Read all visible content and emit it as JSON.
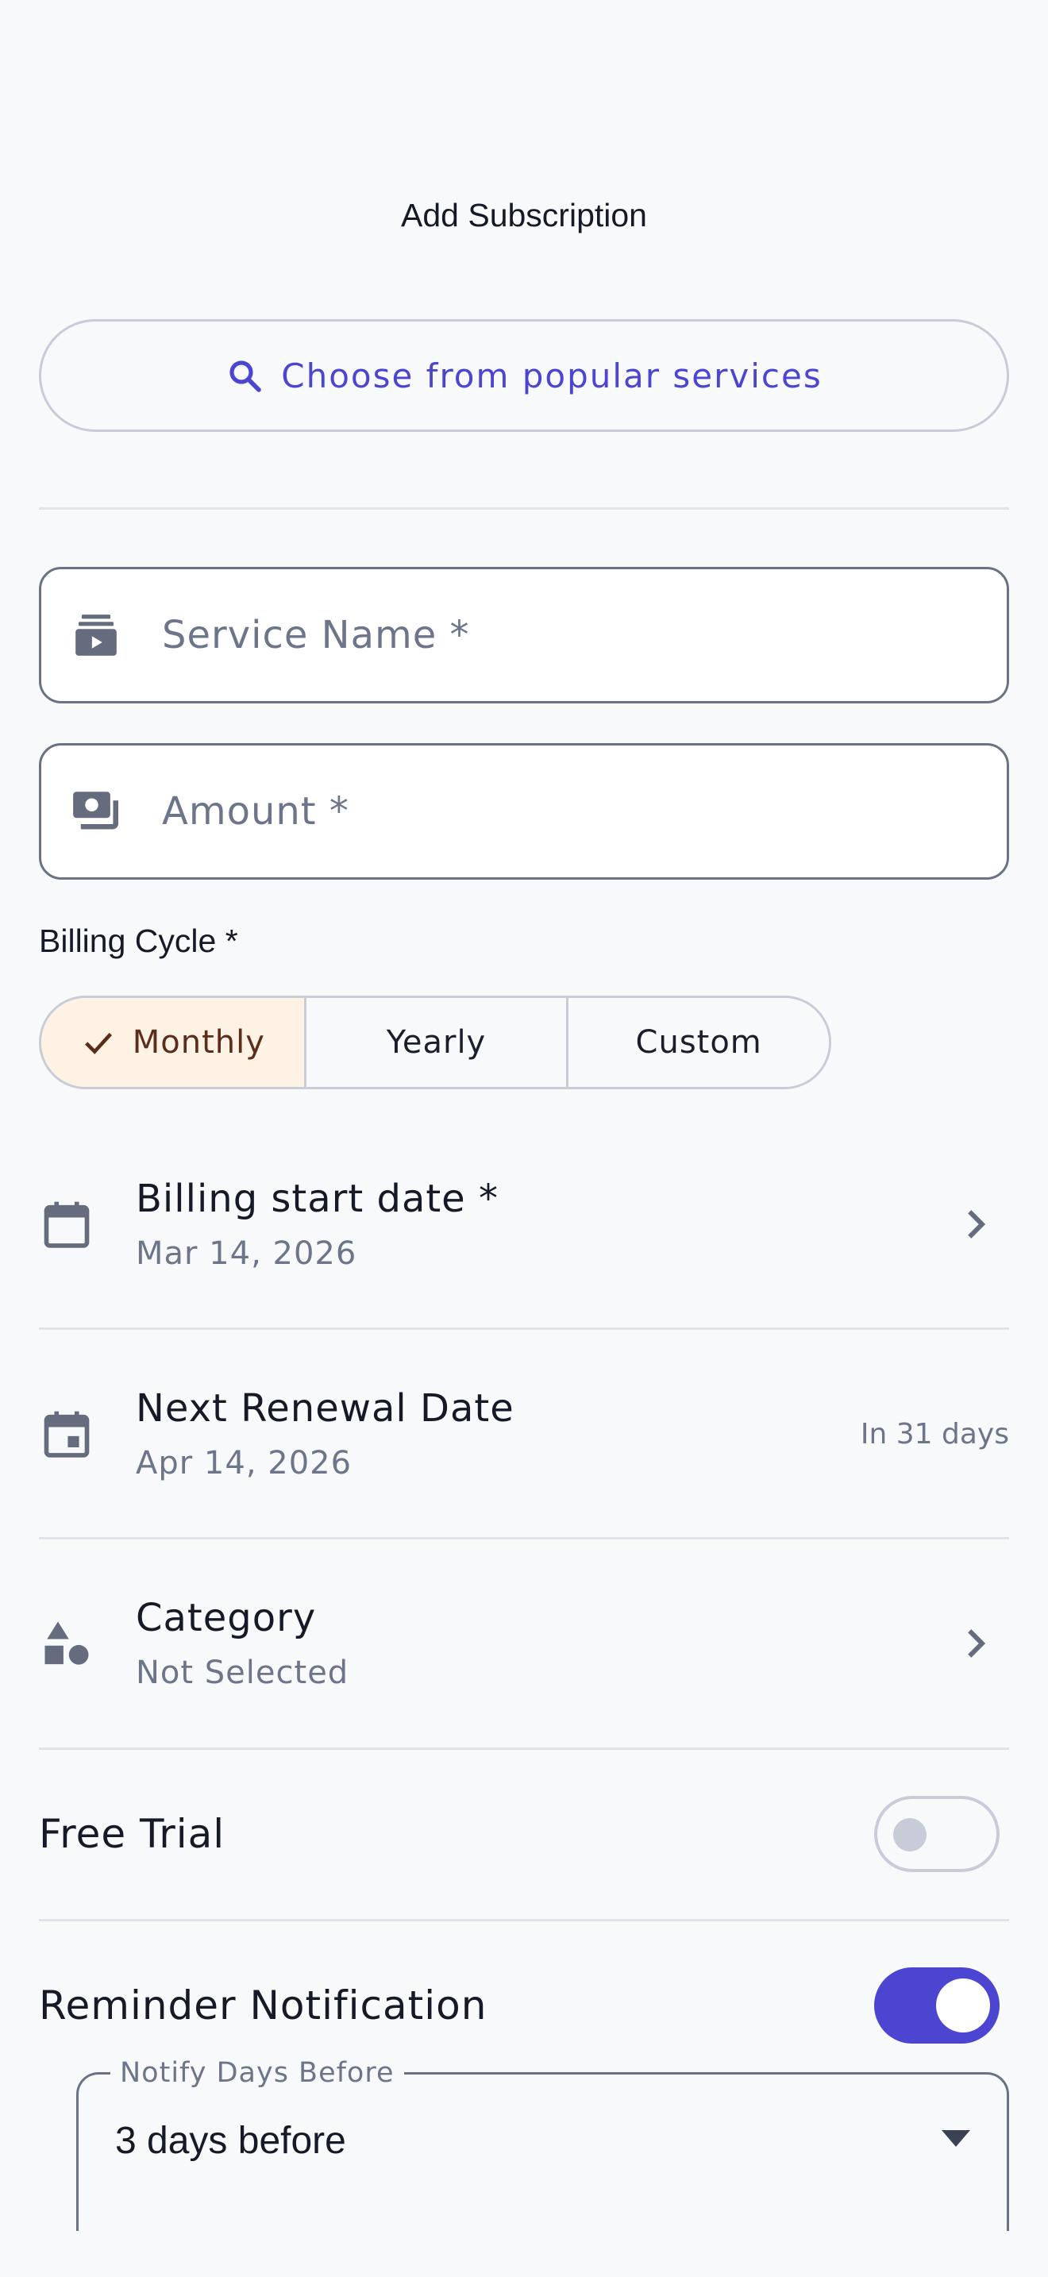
{
  "header": {
    "title": "Add Subscription"
  },
  "popular": {
    "label": "Choose from popular services"
  },
  "form": {
    "service_name": {
      "placeholder": "Service Name *",
      "value": ""
    },
    "amount": {
      "placeholder": "Amount *",
      "value": ""
    }
  },
  "billing_cycle": {
    "label": "Billing Cycle *",
    "options": [
      "Monthly",
      "Yearly",
      "Custom"
    ],
    "selected": "Monthly"
  },
  "billing_start": {
    "label": "Billing start date *",
    "value": "Mar 14, 2026"
  },
  "next_renewal": {
    "label": "Next Renewal Date",
    "value": "Apr 14, 2026",
    "aside": "In 31 days"
  },
  "category": {
    "label": "Category",
    "value": "Not Selected"
  },
  "free_trial": {
    "label": "Free Trial",
    "enabled": false
  },
  "reminder": {
    "label": "Reminder Notification",
    "enabled": true
  },
  "notify": {
    "legend": "Notify Days Before",
    "value": "3 days before"
  },
  "colors": {
    "accent": "#4b45d1",
    "selected_segment_bg": "#fdf2e4",
    "muted_text": "#6c7589"
  }
}
